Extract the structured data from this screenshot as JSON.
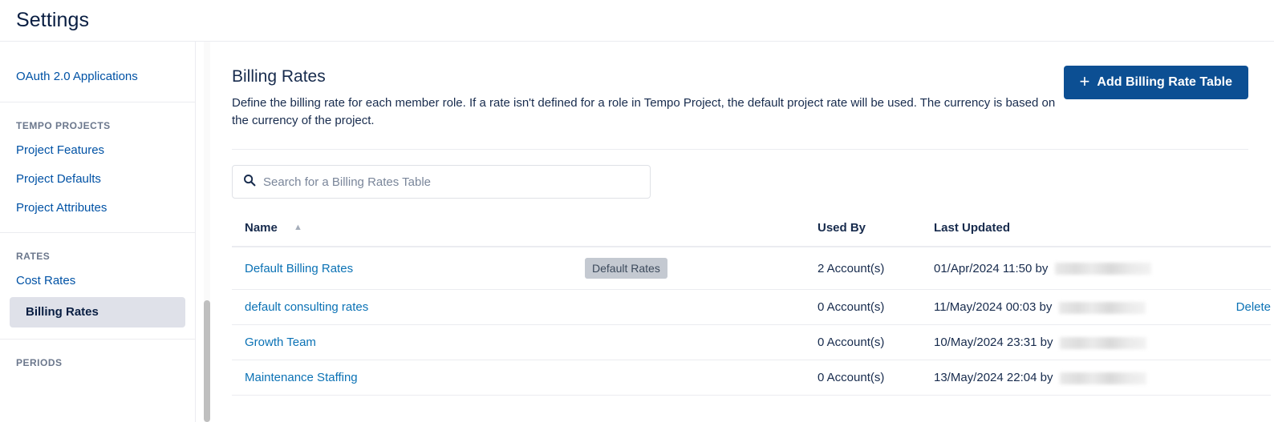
{
  "header": {
    "title": "Settings"
  },
  "sidebar": {
    "groups": [
      {
        "heading": null,
        "items": [
          {
            "label": "OAuth 2.0 Applications",
            "selected": false
          }
        ]
      },
      {
        "heading": "TEMPO PROJECTS",
        "items": [
          {
            "label": "Project Features",
            "selected": false
          },
          {
            "label": "Project Defaults",
            "selected": false
          },
          {
            "label": "Project Attributes",
            "selected": false
          }
        ]
      },
      {
        "heading": "RATES",
        "items": [
          {
            "label": "Cost Rates",
            "selected": false
          },
          {
            "label": "Billing Rates",
            "selected": true
          }
        ]
      },
      {
        "heading": "PERIODS",
        "items": []
      }
    ]
  },
  "main": {
    "title": "Billing Rates",
    "description": "Define the billing rate for each member role. If a rate isn't defined for a role in Tempo Project, the default project rate will be used. The currency is based on the currency of the project.",
    "add_button_label": "Add Billing Rate Table",
    "add_button_icon": "plus-icon",
    "search": {
      "placeholder": "Search for a Billing Rates Table",
      "value": "",
      "icon": "search-icon"
    },
    "table": {
      "columns": [
        "Name",
        "Used By",
        "Last Updated"
      ],
      "sort": {
        "column": "Name",
        "direction": "asc",
        "icon": "chevron-up-icon"
      },
      "rows": [
        {
          "name": "Default Billing Rates",
          "badge": "Default Rates",
          "used_by": "2 Account(s)",
          "last_updated": "01/Apr/2024 11:50 by",
          "updated_by": "",
          "action": null
        },
        {
          "name": "default consulting rates",
          "badge": null,
          "used_by": "0 Account(s)",
          "last_updated": "11/May/2024 00:03 by",
          "updated_by": "",
          "action": "Delete"
        },
        {
          "name": "Growth Team",
          "badge": null,
          "used_by": "0 Account(s)",
          "last_updated": "10/May/2024 23:31 by",
          "updated_by": "",
          "action": null
        },
        {
          "name": "Maintenance Staffing",
          "badge": null,
          "used_by": "0 Account(s)",
          "last_updated": "13/May/2024 22:04 by",
          "updated_by": "",
          "action": null
        }
      ]
    }
  },
  "colors": {
    "accent_blue": "#0c4f93",
    "link_blue": "#0052a5",
    "row_link_blue": "#0b72b5",
    "text_dark": "#172b4d",
    "muted": "#6b778c",
    "selected_bg": "#dfe1e9",
    "badge_bg": "#c4c9d1",
    "border": "#ebecf0"
  }
}
